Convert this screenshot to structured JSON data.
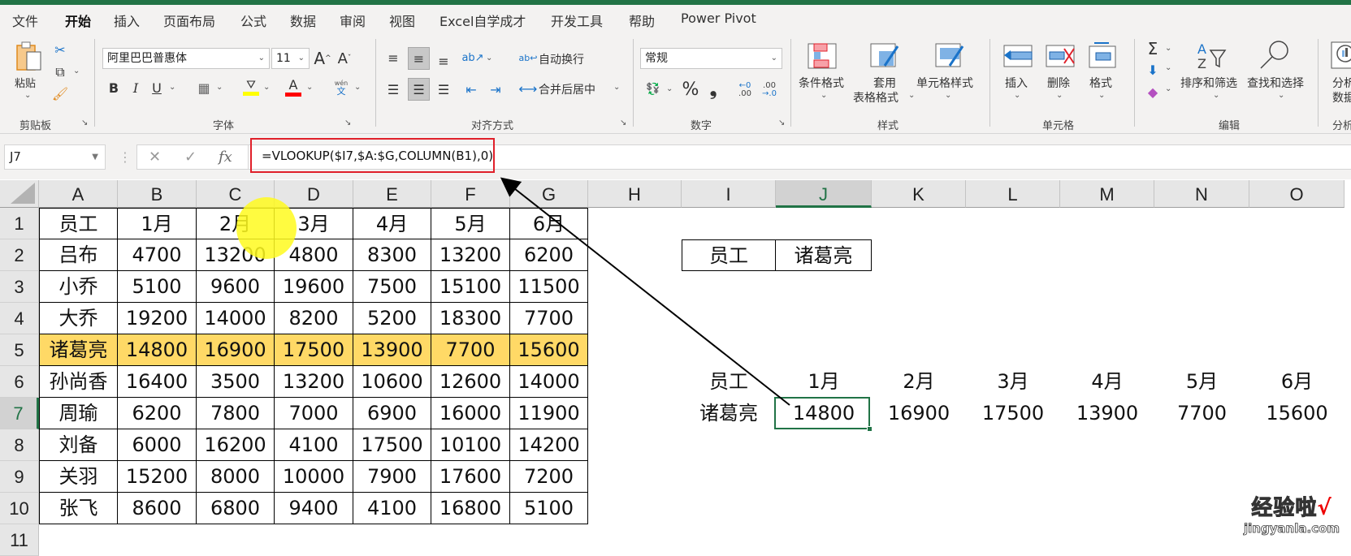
{
  "menu": {
    "tabs": [
      {
        "label": "文件",
        "active": false
      },
      {
        "label": "开始",
        "active": true
      },
      {
        "label": "插入",
        "active": false
      },
      {
        "label": "页面布局",
        "active": false
      },
      {
        "label": "公式",
        "active": false
      },
      {
        "label": "数据",
        "active": false
      },
      {
        "label": "审阅",
        "active": false
      },
      {
        "label": "视图",
        "active": false
      },
      {
        "label": "Excel自学成才",
        "active": false
      },
      {
        "label": "开发工具",
        "active": false
      },
      {
        "label": "帮助",
        "active": false
      },
      {
        "label": "Power Pivot",
        "active": false
      }
    ]
  },
  "ribbon": {
    "clipboard": {
      "paste": "粘贴",
      "group": "剪贴板"
    },
    "font": {
      "name": "阿里巴巴普惠体",
      "size": "11",
      "bold": "B",
      "italic": "I",
      "underline": "U",
      "grow": "A",
      "shrink": "A",
      "phonetic_top": "wén",
      "phonetic_bottom": "文",
      "group": "字体",
      "fill_color": "#ffff00",
      "font_color": "#ff0000"
    },
    "alignment": {
      "wrap": "自动换行",
      "merge": "合并后居中",
      "group": "对齐方式"
    },
    "number": {
      "format": "常规",
      "percent": "%",
      "comma": "9",
      "inc_decimal": ".00",
      "dec_decimal": ".0",
      "group": "数字"
    },
    "styles": {
      "conditional": "条件格式",
      "table_format_1": "套用",
      "table_format_2": "表格格式",
      "cell_styles": "单元格样式",
      "group": "样式"
    },
    "cells": {
      "insert": "插入",
      "delete": "删除",
      "format": "格式",
      "group": "单元格"
    },
    "editing": {
      "sum": "Σ",
      "sort_filter": "排序和筛选",
      "find_select": "查找和选择",
      "group": "编辑"
    },
    "analysis": {
      "label_1": "分析",
      "label_2": "数据",
      "group": "分析"
    }
  },
  "formula_bar": {
    "name_box": "J7",
    "cancel": "✕",
    "enter": "✓",
    "fx": "fx",
    "formula": "=VLOOKUP($I7,$A:$G,COLUMN(B1),0)"
  },
  "sheet": {
    "columns": [
      "A",
      "B",
      "C",
      "D",
      "E",
      "F",
      "G",
      "H",
      "I",
      "J",
      "K",
      "L",
      "M",
      "N",
      "O"
    ],
    "selected_column": "J",
    "rows": [
      "1",
      "2",
      "3",
      "4",
      "5",
      "6",
      "7",
      "8",
      "9",
      "10",
      "11"
    ],
    "selected_row": "7",
    "source_table": {
      "header": [
        "员工",
        "1月",
        "2月",
        "3月",
        "4月",
        "5月",
        "6月"
      ],
      "data": [
        [
          "吕布",
          "4700",
          "13200",
          "4800",
          "8300",
          "13200",
          "6200"
        ],
        [
          "小乔",
          "5100",
          "9600",
          "19600",
          "7500",
          "15100",
          "11500"
        ],
        [
          "大乔",
          "19200",
          "14000",
          "8200",
          "5200",
          "18300",
          "7700"
        ],
        [
          "诸葛亮",
          "14800",
          "16900",
          "17500",
          "13900",
          "7700",
          "15600"
        ],
        [
          "孙尚香",
          "16400",
          "3500",
          "13200",
          "10600",
          "12600",
          "14000"
        ],
        [
          "周瑜",
          "6200",
          "7800",
          "7000",
          "6900",
          "16000",
          "11900"
        ],
        [
          "刘备",
          "6000",
          "16200",
          "4100",
          "17500",
          "10100",
          "14200"
        ],
        [
          "关羽",
          "15200",
          "8000",
          "10000",
          "7900",
          "17600",
          "7200"
        ],
        [
          "张飞",
          "8600",
          "6800",
          "9400",
          "4100",
          "16800",
          "5100"
        ]
      ],
      "highlighted_row_index": 3,
      "highlight_color": "#ffd966"
    },
    "lookup_box": {
      "label": "员工",
      "value": "诸葛亮"
    },
    "result": {
      "header": [
        "员工",
        "1月",
        "2月",
        "3月",
        "4月",
        "5月",
        "6月"
      ],
      "values": [
        "诸葛亮",
        "14800",
        "16900",
        "17500",
        "13900",
        "7700",
        "15600"
      ]
    }
  },
  "watermark": {
    "text": "经验啦",
    "check": "√",
    "url": "jingyanla.com"
  }
}
